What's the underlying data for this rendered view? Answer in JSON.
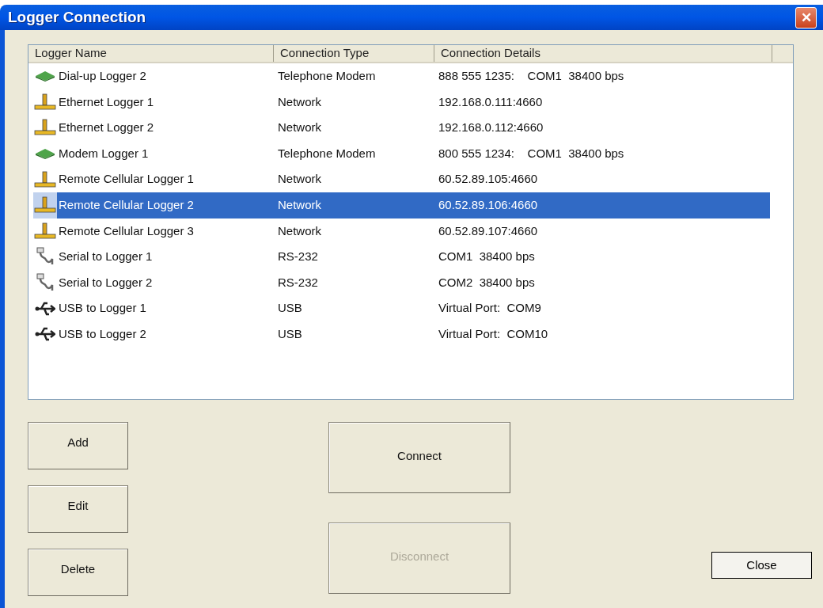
{
  "window": {
    "title": "Logger Connection",
    "close_glyph": "✕"
  },
  "table": {
    "columns": [
      "Logger Name",
      "Connection Type",
      "Connection Details"
    ],
    "rows": [
      {
        "kind": "modem",
        "name": "Dial-up Logger 2",
        "type": "Telephone Modem",
        "details": "888 555 1235:    COM1  38400 bps",
        "selected": false
      },
      {
        "kind": "network",
        "name": "Ethernet Logger 1",
        "type": "Network",
        "details": "192.168.0.111:4660",
        "selected": false
      },
      {
        "kind": "network",
        "name": "Ethernet Logger 2",
        "type": "Network",
        "details": "192.168.0.112:4660",
        "selected": false
      },
      {
        "kind": "modem",
        "name": "Modem Logger 1",
        "type": "Telephone Modem",
        "details": "800 555 1234:    COM1  38400 bps",
        "selected": false
      },
      {
        "kind": "network",
        "name": "Remote Cellular Logger 1",
        "type": "Network",
        "details": "60.52.89.105:4660",
        "selected": false
      },
      {
        "kind": "network",
        "name": "Remote Cellular Logger 2",
        "type": "Network",
        "details": "60.52.89.106:4660",
        "selected": true
      },
      {
        "kind": "network",
        "name": "Remote Cellular Logger 3",
        "type": "Network",
        "details": "60.52.89.107:4660",
        "selected": false
      },
      {
        "kind": "serial",
        "name": "Serial to Logger 1",
        "type": "RS-232",
        "details": "COM1  38400 bps",
        "selected": false
      },
      {
        "kind": "serial",
        "name": "Serial to Logger 2",
        "type": "RS-232",
        "details": "COM2  38400 bps",
        "selected": false
      },
      {
        "kind": "usb",
        "name": "USB to Logger 1",
        "type": "USB",
        "details": "Virtual Port:  COM9",
        "selected": false
      },
      {
        "kind": "usb",
        "name": "USB to Logger 2",
        "type": "USB",
        "details": "Virtual Port:  COM10",
        "selected": false
      }
    ]
  },
  "buttons": {
    "left": [
      {
        "label": "Add",
        "disabled": false
      },
      {
        "label": "Edit",
        "disabled": false
      },
      {
        "label": "Delete",
        "disabled": false
      }
    ],
    "center": [
      {
        "label": "Connect",
        "disabled": false
      },
      {
        "label": "Disconnect",
        "disabled": true
      }
    ],
    "close": {
      "label": "Close",
      "disabled": false
    }
  }
}
